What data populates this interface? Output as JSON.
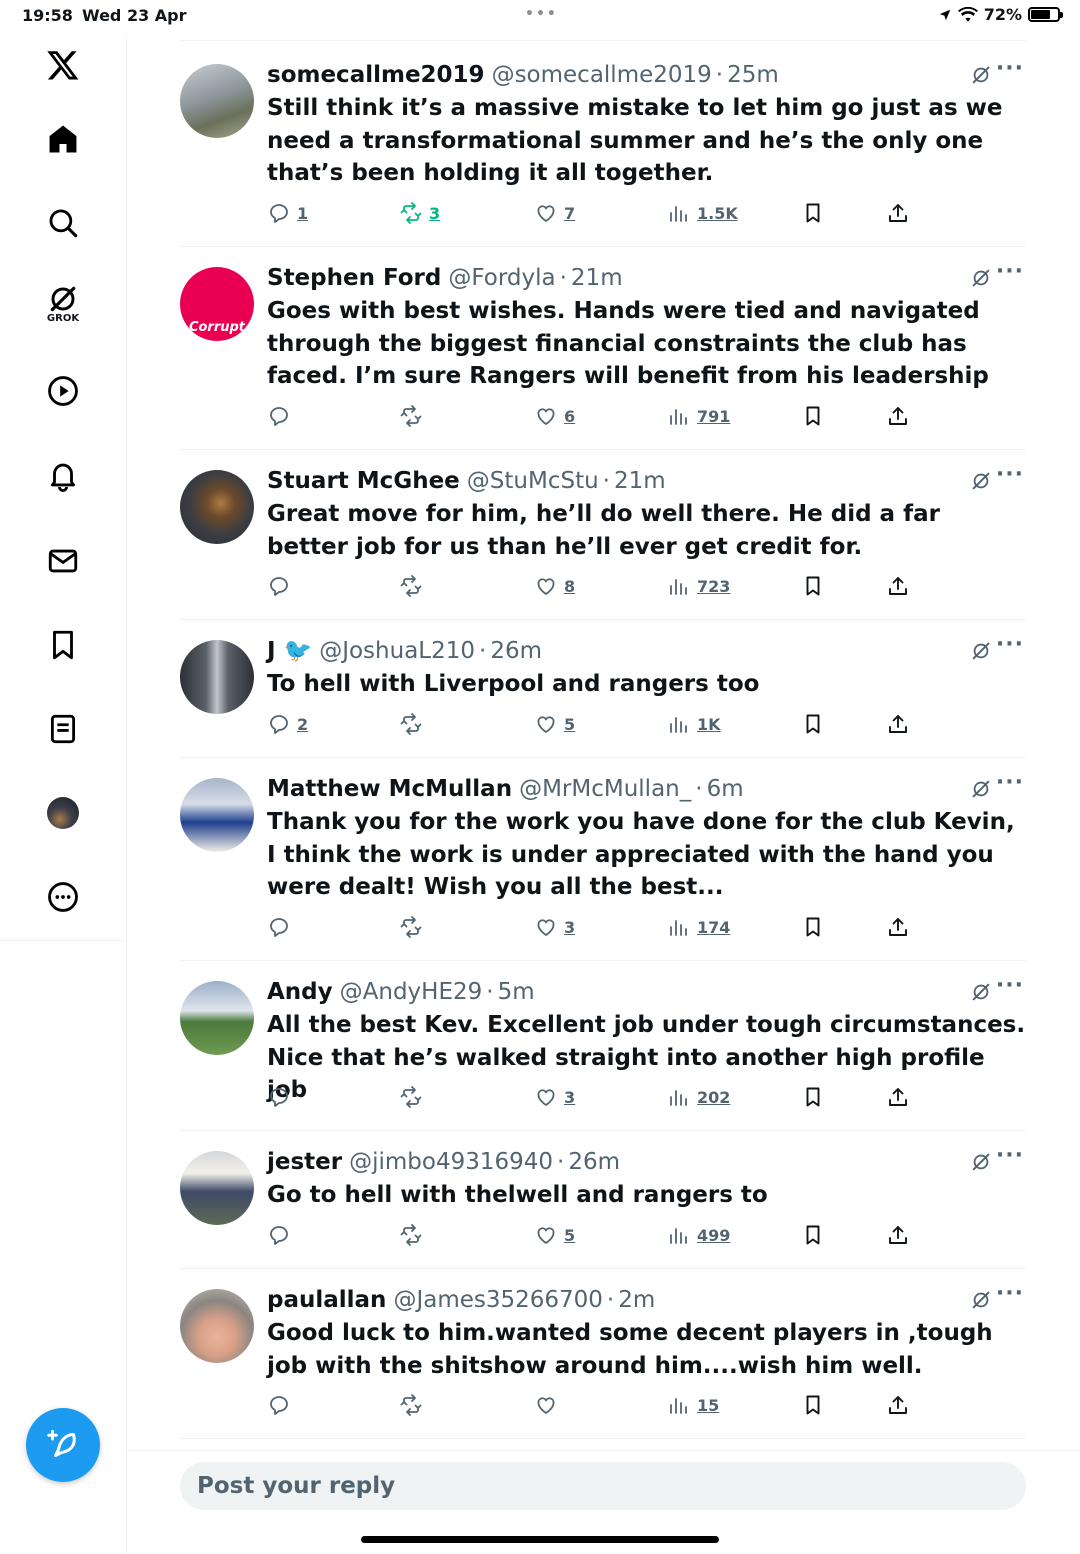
{
  "status_bar": {
    "time": "19:58",
    "date": "Wed 23 Apr",
    "battery": "72%",
    "battery_level": 0.72
  },
  "sidebar": {
    "items": [
      {
        "icon": "x-logo-icon"
      },
      {
        "icon": "home-icon"
      },
      {
        "icon": "search-icon"
      },
      {
        "icon": "grok-icon",
        "label": "GROK"
      },
      {
        "icon": "video-icon"
      },
      {
        "icon": "notifications-icon"
      },
      {
        "icon": "messages-icon"
      },
      {
        "icon": "bookmarks-icon"
      },
      {
        "icon": "lists-icon"
      },
      {
        "icon": "profile-avatar"
      },
      {
        "icon": "more-icon"
      }
    ],
    "compose_icon": "compose-post-icon"
  },
  "tweets": [
    {
      "name": "somecallme2019",
      "handle": "@somecallme2019",
      "age": "25m",
      "text": "Still think it’s a massive mistake to let him go just as we need a transformational summer and he’s the only one that’s been holding it all together.",
      "replies": "1",
      "retweets": "3",
      "likes": "7",
      "views": "1.5K",
      "retweeted": true
    },
    {
      "name": "Stephen Ford",
      "handle": "@Fordyla",
      "age": "21m",
      "text": "Goes with best wishes. Hands were tied and navigated through the biggest financial constraints the club has faced. I’m sure Rangers will benefit from his leadership",
      "replies": "",
      "retweets": "",
      "likes": "6",
      "views": "791",
      "avatar_text": "Corrupt"
    },
    {
      "name": "Stuart McGhee",
      "handle": "@StuMcStu",
      "age": "21m",
      "text": "Great move for him, he’ll do well there. He did a far better job for us than he’ll ever get credit for.",
      "replies": "",
      "retweets": "",
      "likes": "8",
      "views": "723"
    },
    {
      "name": "J 🐦",
      "handle": "@JoshuaL210",
      "age": "26m",
      "text": "To hell with Liverpool and rangers too",
      "replies": "2",
      "retweets": "",
      "likes": "5",
      "views": "1K"
    },
    {
      "name": "Matthew McMullan",
      "handle": "@MrMcMullan_",
      "age": "6m",
      "text": "Thank you for the work you have done for the club Kevin, I think the work is under appreciated with the hand you were dealt! Wish you all the best...",
      "replies": "",
      "retweets": "",
      "likes": "3",
      "views": "174"
    },
    {
      "name": "Andy",
      "handle": "@AndyHE29",
      "age": "5m",
      "text": "All the best Kev. Excellent job under tough circumstances. Nice that he’s walked straight into another high profile job",
      "replies": "",
      "retweets": "",
      "likes": "3",
      "views": "202"
    },
    {
      "name": "jester",
      "handle": "@jimbo49316940",
      "age": "26m",
      "text": "Go to hell with thelwell and rangers to",
      "replies": "",
      "retweets": "",
      "likes": "5",
      "views": "499"
    },
    {
      "name": "paulallan",
      "handle": "@James35266700",
      "age": "2m",
      "text": "Good luck to him.wanted some decent players in ,tough job with the shitshow around him....wish him well.",
      "replies": "",
      "retweets": "",
      "likes": "",
      "views": "15"
    }
  ],
  "reply_box": {
    "placeholder": "Post your reply"
  },
  "colors": {
    "accent": "#1d9bf0",
    "retweet_active": "#00ba7c",
    "secondary_text": "#536471",
    "avatar_ring": "#e90052"
  }
}
